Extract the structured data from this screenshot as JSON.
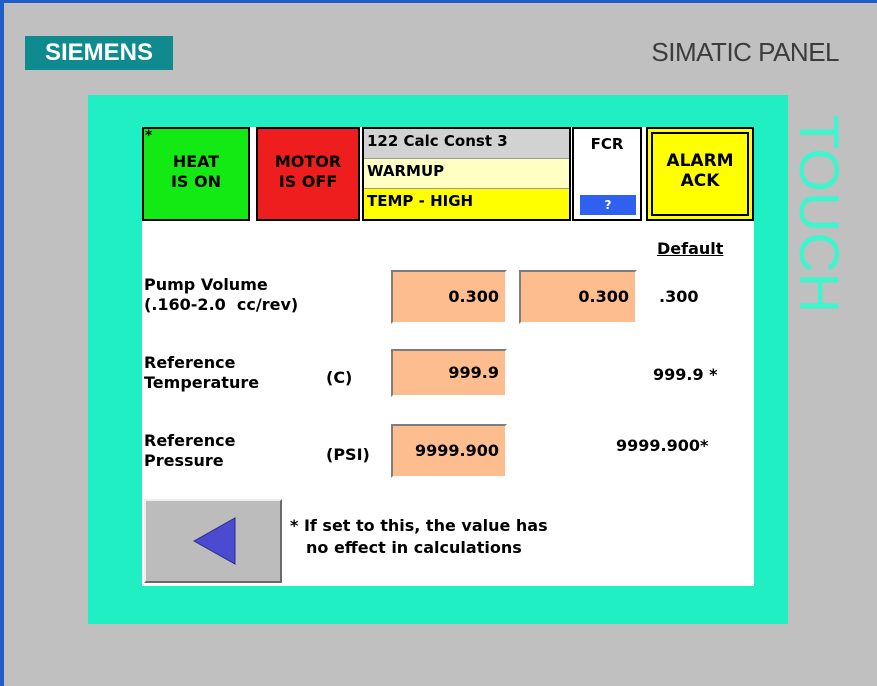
{
  "device": {
    "brand": "SIEMENS",
    "panel_name": "SIMATIC PANEL",
    "touch_label": "TOUCH"
  },
  "header": {
    "heat": {
      "marker": "*",
      "line1": "HEAT",
      "line2": "IS ON",
      "color": "#13ea13"
    },
    "motor": {
      "line1": "MOTOR",
      "line2": "IS OFF",
      "color": "#ee1e1e"
    },
    "status": [
      "122 Calc Const 3",
      "WARMUP",
      "TEMP - HIGH"
    ],
    "fcr": {
      "label": "FCR",
      "help": "?"
    },
    "alarm": {
      "line1": "ALARM",
      "line2": "ACK",
      "color": "#ffff00"
    }
  },
  "table": {
    "default_header": "Default",
    "rows": [
      {
        "label1": "Pump Volume",
        "label2": "(.160-2.0  cc/rev)",
        "unit": "",
        "value": "0.300",
        "value2": "0.300",
        "default": ".300"
      },
      {
        "label1": "Reference",
        "label2": "Temperature",
        "unit": "(C)",
        "value": "999.9",
        "default": "999.9 *"
      },
      {
        "label1": "Reference",
        "label2": "Pressure",
        "unit": "(PSI)",
        "value": "9999.900",
        "default": "9999.900*"
      }
    ]
  },
  "footer": {
    "note_line1": "* If set to this, the value has",
    "note_line2": "no effect in calculations",
    "back_icon": "left-triangle-icon"
  },
  "colors": {
    "bezel": "#1fefc2",
    "input_field": "#fdbd8f",
    "fcr_help": "#3060f0"
  }
}
